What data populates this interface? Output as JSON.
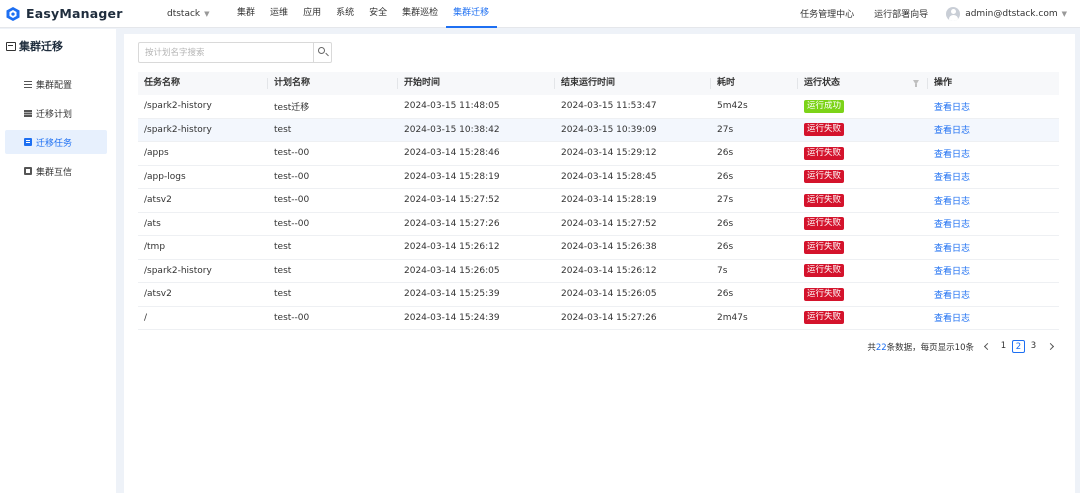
{
  "app": {
    "name": "EasyManager"
  },
  "header": {
    "cluster": "dtstack",
    "nav": [
      {
        "label": "集群",
        "active": false
      },
      {
        "label": "运维",
        "active": false
      },
      {
        "label": "应用",
        "active": false
      },
      {
        "label": "系统",
        "active": false
      },
      {
        "label": "安全",
        "active": false
      },
      {
        "label": "集群巡检",
        "active": false
      },
      {
        "label": "集群迁移",
        "active": true
      }
    ],
    "task_center": "任务管理中心",
    "deploy_wizard": "运行部署向导",
    "user": "admin@dtstack.com"
  },
  "sidebar": {
    "title": "集群迁移",
    "items": [
      {
        "label": "集群配置",
        "icon": "sliders-icon",
        "active": false
      },
      {
        "label": "迁移计划",
        "icon": "list-icon",
        "active": false
      },
      {
        "label": "迁移任务",
        "icon": "task-icon",
        "active": true
      },
      {
        "label": "集群互信",
        "icon": "trust-icon",
        "active": false
      }
    ]
  },
  "search": {
    "placeholder": "按计划名字搜索"
  },
  "table": {
    "columns": [
      "任务名称",
      "计划名称",
      "开始时间",
      "结束运行时间",
      "耗时",
      "运行状态",
      "操作"
    ],
    "rows": [
      {
        "task": "/spark2-history",
        "plan": "test迁移",
        "start": "2024-03-15 11:48:05",
        "end": "2024-03-15 11:53:47",
        "duration": "5m42s",
        "status": "运行成功",
        "status_type": "ok",
        "action": "查看日志"
      },
      {
        "task": "/spark2-history",
        "plan": "test",
        "start": "2024-03-15 10:38:42",
        "end": "2024-03-15 10:39:09",
        "duration": "27s",
        "status": "运行失败",
        "status_type": "fail",
        "action": "查看日志"
      },
      {
        "task": "/apps",
        "plan": "test--00",
        "start": "2024-03-14 15:28:46",
        "end": "2024-03-14 15:29:12",
        "duration": "26s",
        "status": "运行失败",
        "status_type": "fail",
        "action": "查看日志"
      },
      {
        "task": "/app-logs",
        "plan": "test--00",
        "start": "2024-03-14 15:28:19",
        "end": "2024-03-14 15:28:45",
        "duration": "26s",
        "status": "运行失败",
        "status_type": "fail",
        "action": "查看日志"
      },
      {
        "task": "/atsv2",
        "plan": "test--00",
        "start": "2024-03-14 15:27:52",
        "end": "2024-03-14 15:28:19",
        "duration": "27s",
        "status": "运行失败",
        "status_type": "fail",
        "action": "查看日志"
      },
      {
        "task": "/ats",
        "plan": "test--00",
        "start": "2024-03-14 15:27:26",
        "end": "2024-03-14 15:27:52",
        "duration": "26s",
        "status": "运行失败",
        "status_type": "fail",
        "action": "查看日志"
      },
      {
        "task": "/tmp",
        "plan": "test",
        "start": "2024-03-14 15:26:12",
        "end": "2024-03-14 15:26:38",
        "duration": "26s",
        "status": "运行失败",
        "status_type": "fail",
        "action": "查看日志"
      },
      {
        "task": "/spark2-history",
        "plan": "test",
        "start": "2024-03-14 15:26:05",
        "end": "2024-03-14 15:26:12",
        "duration": "7s",
        "status": "运行失败",
        "status_type": "fail",
        "action": "查看日志"
      },
      {
        "task": "/atsv2",
        "plan": "test",
        "start": "2024-03-14 15:25:39",
        "end": "2024-03-14 15:26:05",
        "duration": "26s",
        "status": "运行失败",
        "status_type": "fail",
        "action": "查看日志"
      },
      {
        "task": "/",
        "plan": "test--00",
        "start": "2024-03-14 15:24:39",
        "end": "2024-03-14 15:27:26",
        "duration": "2m47s",
        "status": "运行失败",
        "status_type": "fail",
        "action": "查看日志"
      }
    ]
  },
  "pagination": {
    "prefix": "共",
    "total": "22",
    "suffix": "条数据，每页显示10条",
    "pages": [
      "1",
      "2",
      "3"
    ],
    "current": "2"
  },
  "colors": {
    "accent": "#1d6ff2",
    "success": "#7cd318",
    "failure": "#d4132c"
  }
}
